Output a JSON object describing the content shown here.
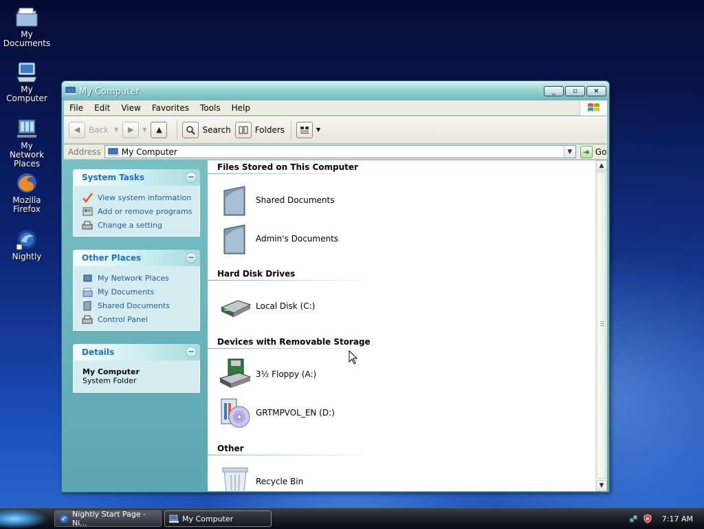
{
  "desktop": {
    "icons": [
      {
        "label": "My Documents"
      },
      {
        "label": "My Computer"
      },
      {
        "label": "My Network Places"
      },
      {
        "label": "Mozilla Firefox"
      },
      {
        "label": "Nightly"
      }
    ]
  },
  "window": {
    "title": "My Computer",
    "menu": [
      "File",
      "Edit",
      "View",
      "Favorites",
      "Tools",
      "Help"
    ],
    "toolbar": {
      "back": "Back",
      "search": "Search",
      "folders": "Folders"
    },
    "address": {
      "label": "Address",
      "value": "My Computer",
      "go": "Go"
    },
    "taskpane": {
      "system_tasks": {
        "title": "System Tasks",
        "items": [
          "View system information",
          "Add or remove programs",
          "Change a setting"
        ]
      },
      "other_places": {
        "title": "Other Places",
        "items": [
          "My Network Places",
          "My Documents",
          "Shared Documents",
          "Control Panel"
        ]
      },
      "details": {
        "title": "Details",
        "name": "My Computer",
        "type": "System Folder"
      }
    },
    "groups": [
      {
        "title": "Files Stored on This Computer",
        "items": [
          "Shared Documents",
          "Admin's Documents"
        ]
      },
      {
        "title": "Hard Disk Drives",
        "items": [
          "Local Disk (C:)"
        ]
      },
      {
        "title": "Devices with Removable Storage",
        "items": [
          "3½ Floppy (A:)",
          "GRTMPVOL_EN (D:)"
        ]
      },
      {
        "title": "Other",
        "items": [
          "Recycle Bin"
        ]
      }
    ]
  },
  "taskbar": {
    "tasks": [
      "Nightly Start Page - Ni...",
      "My Computer"
    ],
    "clock": "7:17 AM"
  },
  "colors": {
    "taskpane_link": "#1e5aa8",
    "taskpane_header": "#1f6fd6",
    "window_frame": "#7fc8c7"
  }
}
